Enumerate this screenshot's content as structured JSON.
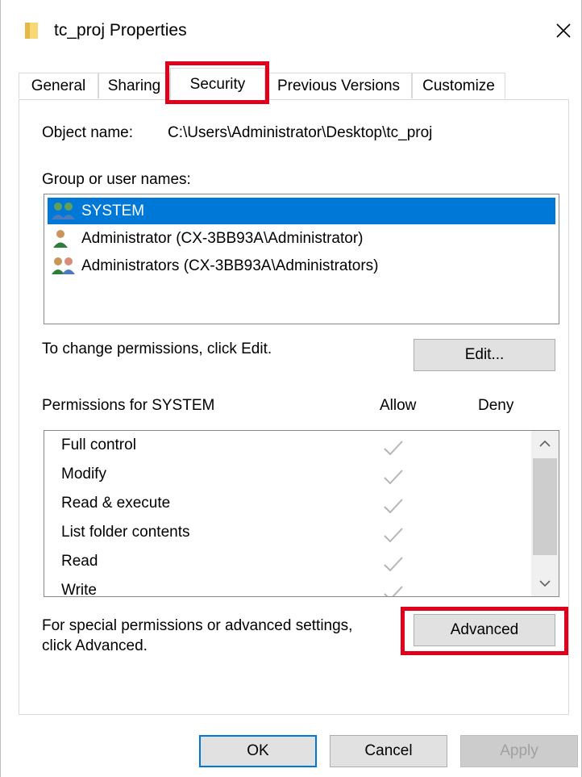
{
  "window": {
    "title": "tc_proj Properties"
  },
  "tabs": [
    {
      "label": "General"
    },
    {
      "label": "Sharing"
    },
    {
      "label": "Security"
    },
    {
      "label": "Previous Versions"
    },
    {
      "label": "Customize"
    }
  ],
  "security": {
    "object_name_label": "Object name:",
    "object_name_value": "C:\\Users\\Administrator\\Desktop\\tc_proj",
    "group_label": "Group or user names:",
    "users": [
      {
        "name": "SYSTEM",
        "icon": "user-group-icon"
      },
      {
        "name": "Administrator (CX-3BB93A\\Administrator)",
        "icon": "user-icon"
      },
      {
        "name": "Administrators (CX-3BB93A\\Administrators)",
        "icon": "user-group-icon"
      }
    ],
    "change_hint": "To change permissions, click Edit.",
    "edit_label": "Edit...",
    "permissions_header": "Permissions for SYSTEM",
    "allow_header": "Allow",
    "deny_header": "Deny",
    "permissions": [
      {
        "name": "Full control",
        "allow": true,
        "deny": false
      },
      {
        "name": "Modify",
        "allow": true,
        "deny": false
      },
      {
        "name": "Read & execute",
        "allow": true,
        "deny": false
      },
      {
        "name": "List folder contents",
        "allow": true,
        "deny": false
      },
      {
        "name": "Read",
        "allow": true,
        "deny": false
      },
      {
        "name": "Write",
        "allow": true,
        "deny": false
      }
    ],
    "special_hint_line1": "For special permissions or advanced settings,",
    "special_hint_line2": "click Advanced.",
    "advanced_label": "Advanced"
  },
  "footer": {
    "ok_label": "OK",
    "cancel_label": "Cancel",
    "apply_label": "Apply"
  },
  "colors": {
    "selection": "#0078d7",
    "highlight": "#e0001b",
    "folder": "#f8d775"
  }
}
